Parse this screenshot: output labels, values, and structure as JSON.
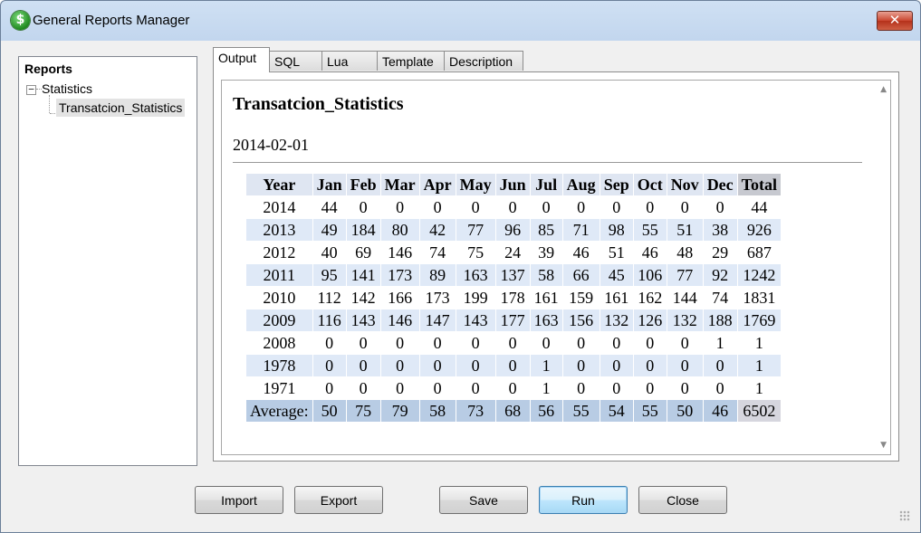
{
  "window": {
    "title": "General Reports Manager",
    "close_glyph": "✕",
    "app_icon": "dollar-coin-icon",
    "app_icon_glyph": "$"
  },
  "tree": {
    "root_label": "Reports",
    "node_label": "Statistics",
    "toggle_glyph": "−",
    "leaf_label": "Transatcion_Statistics"
  },
  "tabs": [
    {
      "label": "Output",
      "active": true
    },
    {
      "label": "SQL",
      "active": false
    },
    {
      "label": "Lua",
      "active": false
    },
    {
      "label": "Template",
      "active": false
    },
    {
      "label": "Description",
      "active": false
    }
  ],
  "report": {
    "title": "Transatcion_Statistics",
    "date": "2014-02-01",
    "columns": [
      "Year",
      "Jan",
      "Feb",
      "Mar",
      "Apr",
      "May",
      "Jun",
      "Jul",
      "Aug",
      "Sep",
      "Oct",
      "Nov",
      "Dec",
      "Total"
    ],
    "rows": [
      [
        "2014",
        "44",
        "0",
        "0",
        "0",
        "0",
        "0",
        "0",
        "0",
        "0",
        "0",
        "0",
        "0",
        "44"
      ],
      [
        "2013",
        "49",
        "184",
        "80",
        "42",
        "77",
        "96",
        "85",
        "71",
        "98",
        "55",
        "51",
        "38",
        "926"
      ],
      [
        "2012",
        "40",
        "69",
        "146",
        "74",
        "75",
        "24",
        "39",
        "46",
        "51",
        "46",
        "48",
        "29",
        "687"
      ],
      [
        "2011",
        "95",
        "141",
        "173",
        "89",
        "163",
        "137",
        "58",
        "66",
        "45",
        "106",
        "77",
        "92",
        "1242"
      ],
      [
        "2010",
        "112",
        "142",
        "166",
        "173",
        "199",
        "178",
        "161",
        "159",
        "161",
        "162",
        "144",
        "74",
        "1831"
      ],
      [
        "2009",
        "116",
        "143",
        "146",
        "147",
        "143",
        "177",
        "163",
        "156",
        "132",
        "126",
        "132",
        "188",
        "1769"
      ],
      [
        "2008",
        "0",
        "0",
        "0",
        "0",
        "0",
        "0",
        "0",
        "0",
        "0",
        "0",
        "0",
        "1",
        "1"
      ],
      [
        "1978",
        "0",
        "0",
        "0",
        "0",
        "0",
        "0",
        "1",
        "0",
        "0",
        "0",
        "0",
        "0",
        "1"
      ],
      [
        "1971",
        "0",
        "0",
        "0",
        "0",
        "0",
        "0",
        "1",
        "0",
        "0",
        "0",
        "0",
        "0",
        "1"
      ]
    ],
    "average_row": [
      "Average:",
      "50",
      "75",
      "79",
      "58",
      "73",
      "68",
      "56",
      "55",
      "54",
      "55",
      "50",
      "46",
      "6502"
    ]
  },
  "buttons": {
    "import": "Import",
    "export": "Export",
    "save": "Save",
    "run": "Run",
    "close": "Close"
  }
}
